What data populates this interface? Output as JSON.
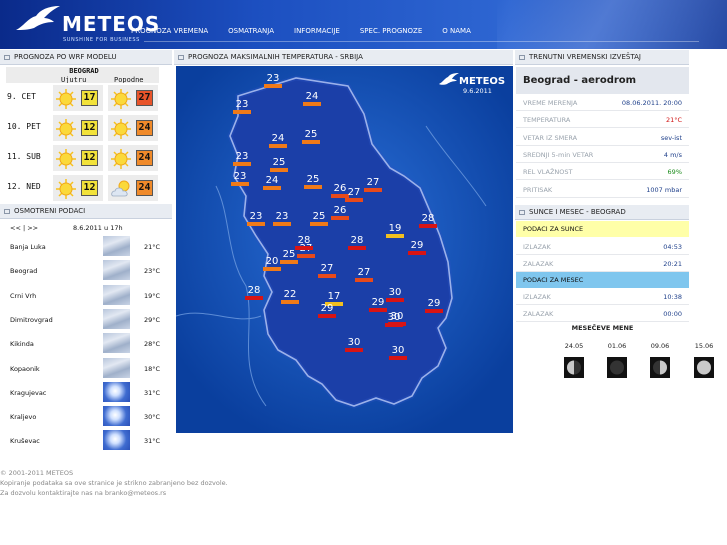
{
  "header": {
    "logo": "METEOS",
    "tagline": "SUNSHINE FOR BUSINESS",
    "nav": [
      "PROGNOZA VREMENA",
      "OSMATRANJA",
      "INFORMACIJE",
      "SPEC. PROGNOZE",
      "O NAMA"
    ]
  },
  "wrf": {
    "title": "PROGNOZA PO WRF MODELU",
    "city": "BEOGRAD",
    "col_morning": "Ujutru",
    "col_afternoon": "Popodne",
    "rows": [
      {
        "day": "9. CET",
        "am_icon": "sun-icon",
        "am_temp": "17",
        "am_color": "#f2e23a",
        "pm_icon": "sun-icon",
        "pm_temp": "27",
        "pm_color": "#e8542a"
      },
      {
        "day": "10. PET",
        "am_icon": "sun-icon",
        "am_temp": "12",
        "am_color": "#f2e23a",
        "pm_icon": "sun-icon",
        "pm_temp": "24",
        "pm_color": "#f08a2a"
      },
      {
        "day": "11. SUB",
        "am_icon": "sun-icon",
        "am_temp": "12",
        "am_color": "#f2e23a",
        "pm_icon": "sun-icon",
        "pm_temp": "24",
        "pm_color": "#f08a2a"
      },
      {
        "day": "12. NED",
        "am_icon": "sun-icon",
        "am_temp": "12",
        "am_color": "#f2e23a",
        "pm_icon": "partly-cloudy-icon",
        "pm_temp": "24",
        "pm_color": "#f08a2a"
      }
    ]
  },
  "observed": {
    "title": "OSMOTRENI PODACI",
    "pager": "<< | >>",
    "date": "8.6.2011 u 17h",
    "rows": [
      {
        "name": "Banja Luka",
        "icon": "cloudy-icon",
        "temp": "21°C"
      },
      {
        "name": "Beograd",
        "icon": "cloudy-icon",
        "temp": "23°C"
      },
      {
        "name": "Crni Vrh",
        "icon": "cloudy-icon",
        "temp": "19°C"
      },
      {
        "name": "Dimitrovgrad",
        "icon": "cloudy-icon",
        "temp": "29°C"
      },
      {
        "name": "Kikinda",
        "icon": "cloudy-icon",
        "temp": "28°C"
      },
      {
        "name": "Kopaonik",
        "icon": "cloudy-icon",
        "temp": "18°C"
      },
      {
        "name": "Kragujevac",
        "icon": "sun-cloud-icon",
        "temp": "31°C"
      },
      {
        "name": "Kraljevo",
        "icon": "sun-cloud-icon",
        "temp": "30°C"
      },
      {
        "name": "Kruševac",
        "icon": "sun-cloud-icon",
        "temp": "31°C"
      }
    ]
  },
  "map": {
    "title": "PROGNOZA MAKSIMALNIH TEMPERATURA - SRBIJA",
    "logo": "METEOS",
    "date": "9.6.2011",
    "labels": [
      "23",
      "24",
      "23",
      "25",
      "24",
      "23",
      "25",
      "23",
      "24",
      "25",
      "26",
      "27",
      "27",
      "23",
      "23",
      "25",
      "26",
      "28",
      "19",
      "28",
      "29",
      "25",
      "27",
      "27",
      "20",
      "28",
      "27",
      "28",
      "22",
      "17",
      "29",
      "29",
      "30",
      "29",
      "30",
      "30",
      "30",
      "30"
    ]
  },
  "report": {
    "title": "TRENUTNI VREMENSKI IZVEŠTAJ",
    "station": "Beograd - aerodrom",
    "items": [
      {
        "k": "VREME MERENJA",
        "v": "08.06.2011. 20:00",
        "c": "#1e3f8a"
      },
      {
        "k": "TEMPERATURA",
        "v": "21°C",
        "c": "#d01010"
      },
      {
        "k": "VETAR IZ SMERA",
        "v": "sev-ist",
        "c": "#1e3f8a"
      },
      {
        "k": "SREDNJI 5-min VETAR",
        "v": "4 m/s",
        "c": "#1e3f8a"
      },
      {
        "k": "REL VLAŽNOST",
        "v": "69%",
        "c": "#1a8a1a"
      },
      {
        "k": "PRITISAK",
        "v": "1007 mbar",
        "c": "#1e3f8a"
      }
    ]
  },
  "sunmoon": {
    "title": "SUNCE I MESEC - BEOGRAD",
    "sun_header": "PODACI ZA SUNCE",
    "sun": [
      {
        "k": "IZLAZAK",
        "v": "04:53"
      },
      {
        "k": "ZALAZAK",
        "v": "20:21"
      }
    ],
    "moon_header": "PODACI ZA MESEC",
    "moon": [
      {
        "k": "IZLAZAK",
        "v": "10:38"
      },
      {
        "k": "ZALAZAK",
        "v": "00:00"
      }
    ],
    "phases_title": "MESEČEVE MENE",
    "phases": [
      {
        "date": "24.05",
        "icon": "last-quarter-moon-icon"
      },
      {
        "date": "01.06",
        "icon": "new-moon-icon"
      },
      {
        "date": "09.06",
        "icon": "first-quarter-moon-icon"
      },
      {
        "date": "15.06",
        "icon": "full-moon-icon"
      }
    ]
  },
  "footer": {
    "line1": "© 2001-2011 METEOS",
    "line2": "Kopiranje podataka sa ove stranice je strikno zabranjeno bez dozvole.",
    "line3": "Za dozvolu kontaktirajte nas na branko@meteos.rs"
  }
}
